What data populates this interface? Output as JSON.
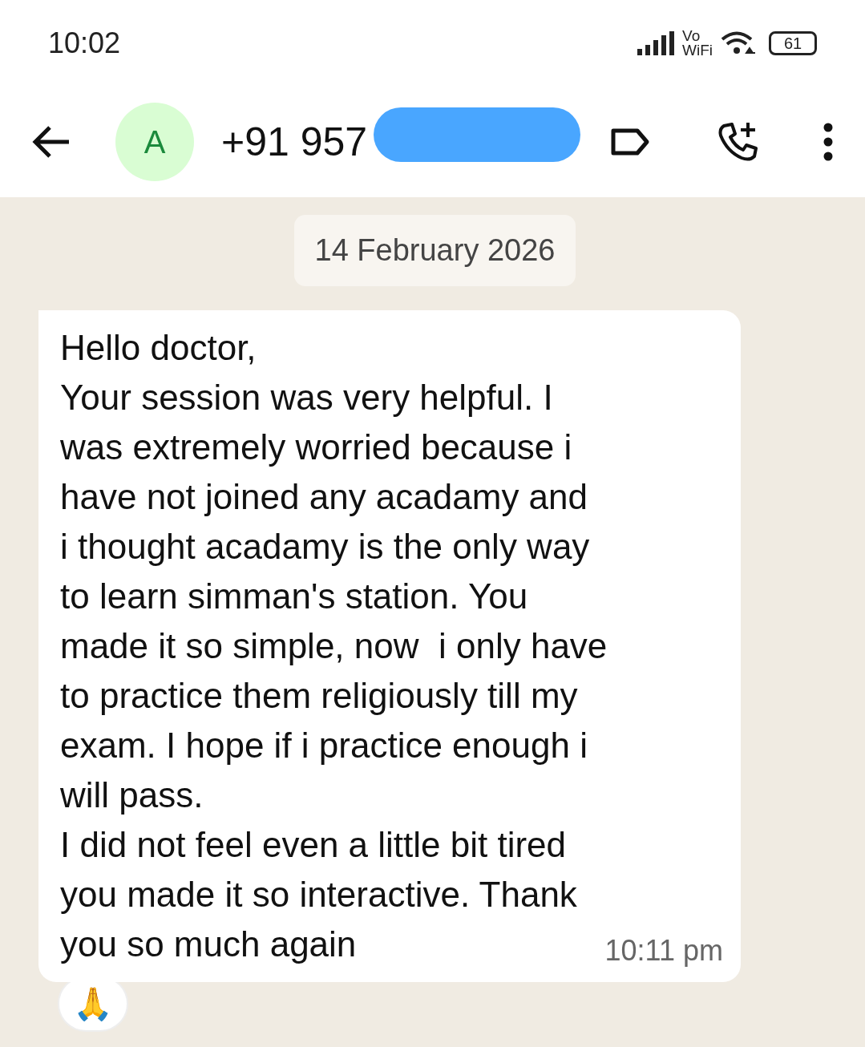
{
  "status_bar": {
    "time": "10:02",
    "network_label_top": "Vo",
    "network_label_bottom": "WiFi",
    "battery": "61"
  },
  "header": {
    "avatar_letter": "A",
    "phone_number": "+91 957"
  },
  "date_chip": "14 February 2026",
  "message": {
    "lines": [
      "Hello doctor,",
      "Your session was very helpful. I",
      "was extremely worried because i",
      "have not joined any acadamy and",
      "i thought acadamy is the only way",
      "to learn simman's station. You",
      "made it so simple, now  i only have",
      "to practice them religiously till my",
      "exam. I hope if i practice enough i",
      "will pass.",
      "I did not feel even a little bit tired",
      "you made it so interactive. Thank",
      "you so much again"
    ],
    "time": "10:11 pm",
    "reaction": "🙏"
  }
}
